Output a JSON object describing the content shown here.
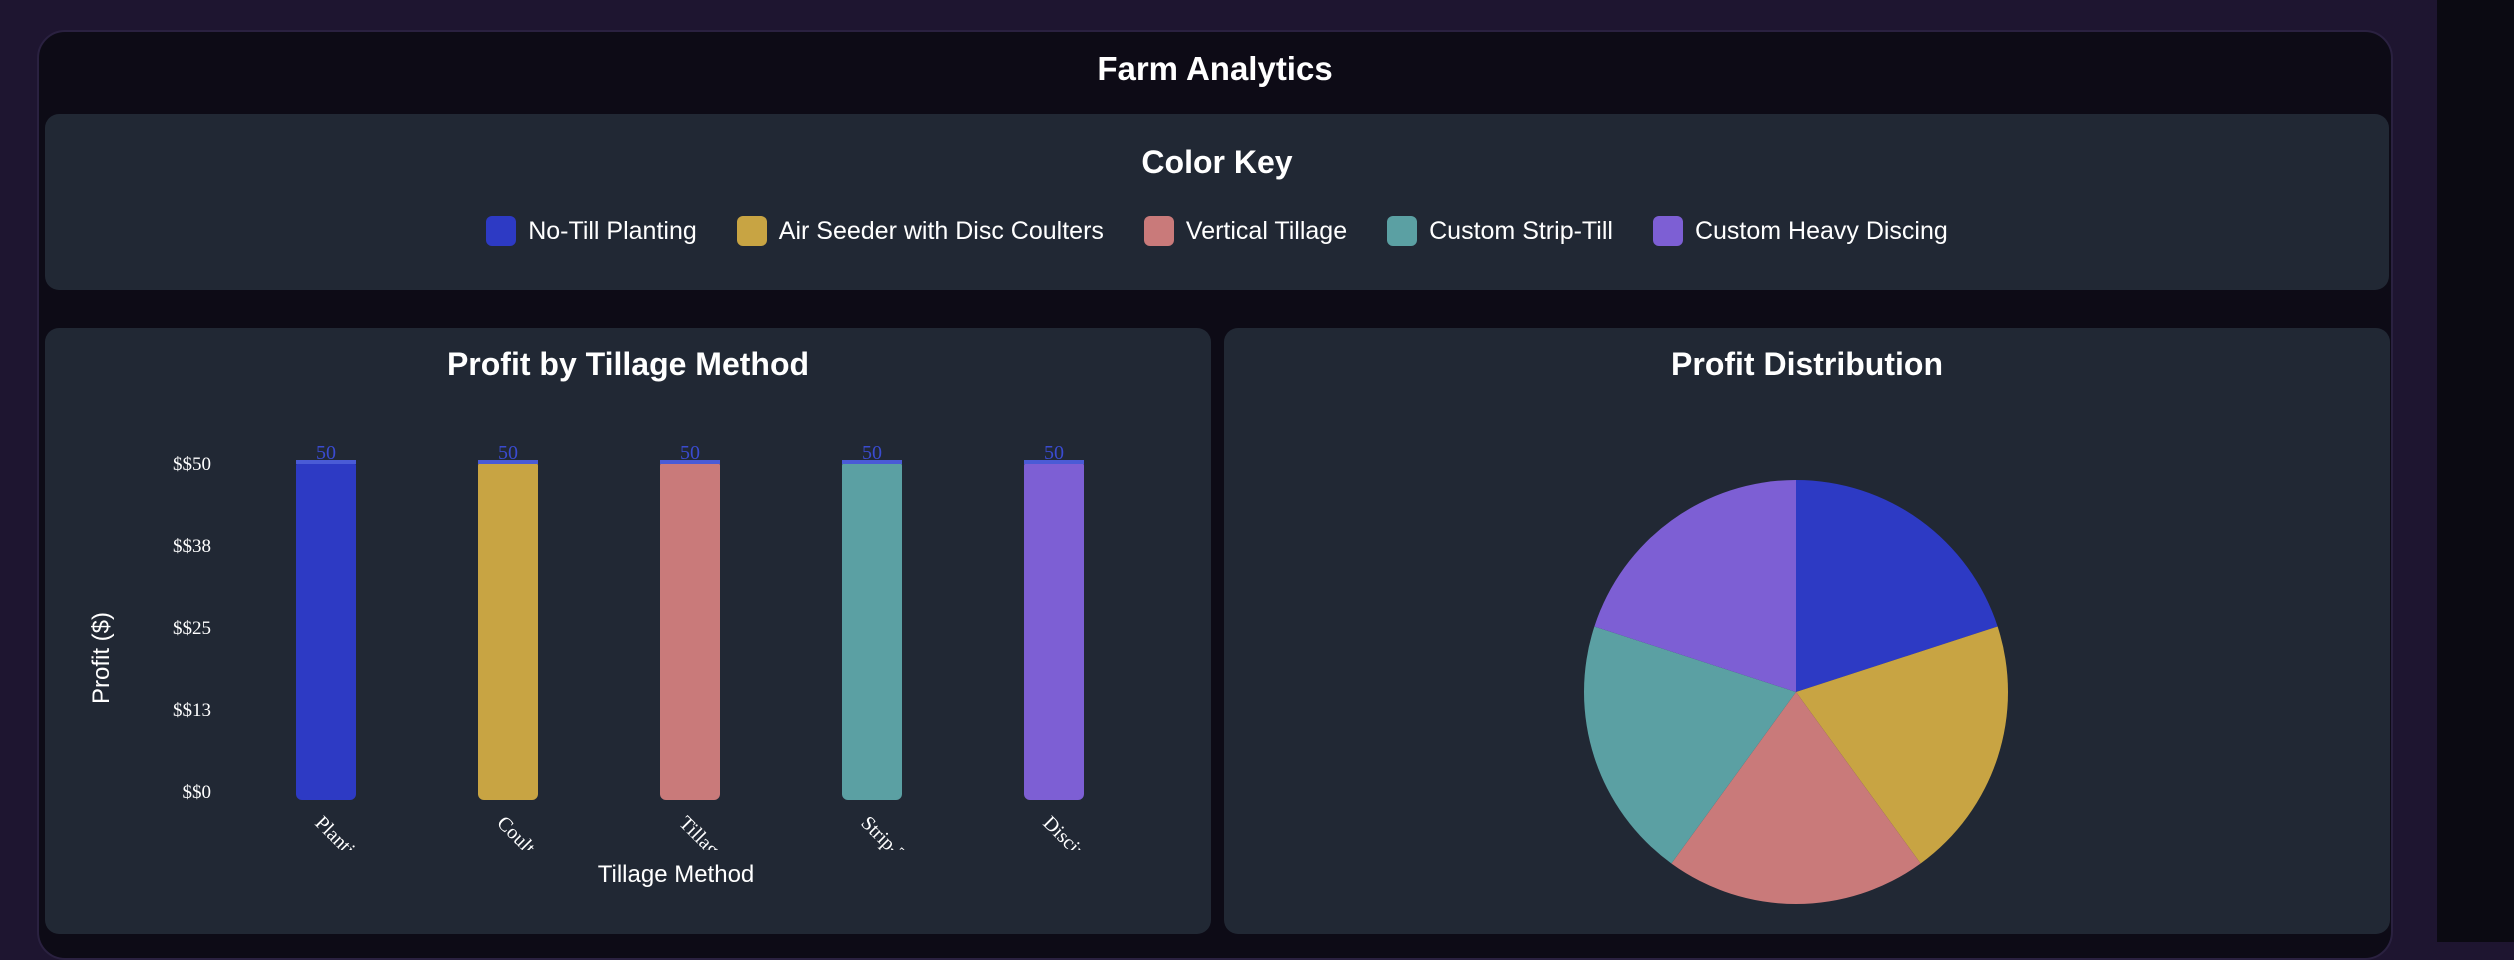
{
  "app": {
    "title": "Farm Analytics"
  },
  "legend": {
    "title": "Color Key",
    "items": [
      {
        "label": "No-Till Planting",
        "color": "#2d3ac4"
      },
      {
        "label": "Air Seeder with Disc Coulters",
        "color": "#c8a443"
      },
      {
        "label": "Vertical Tillage",
        "color": "#c97a7a"
      },
      {
        "label": "Custom Strip-Till",
        "color": "#5ba0a3"
      },
      {
        "label": "Custom Heavy Discing",
        "color": "#7d5fd4"
      }
    ]
  },
  "bar_panel": {
    "title": "Profit by Tillage Method"
  },
  "pie_panel": {
    "title": "Profit Distribution"
  },
  "chart_data": [
    {
      "type": "bar",
      "title": "Profit by Tillage Method",
      "xlabel": "Tillage Method",
      "ylabel": "Profit ($)",
      "categories": [
        "Planti",
        "Coult",
        "Tillag",
        "Strip-T",
        "Discir"
      ],
      "values": [
        50,
        50,
        50,
        50,
        50
      ],
      "colors": [
        "#2d3ac4",
        "#c8a443",
        "#c97a7a",
        "#5ba0a3",
        "#7d5fd4"
      ],
      "data_labels": [
        "50",
        "50",
        "50",
        "50",
        "50"
      ],
      "ylim": [
        0,
        50
      ],
      "y_ticks": [
        0,
        12.5,
        25,
        37.5,
        50
      ],
      "y_tick_labels": [
        "$$0",
        "$$13",
        "$$25",
        "$$38",
        "$$50"
      ],
      "grid": false,
      "accent_color": "#4a5bd6"
    },
    {
      "type": "pie",
      "title": "Profit Distribution",
      "labels": [
        "No-Till Planting",
        "Air Seeder with Disc Coulters",
        "Vertical Tillage",
        "Custom Strip-Till",
        "Custom Heavy Discing"
      ],
      "values": [
        50,
        50,
        50,
        50,
        50
      ],
      "colors": [
        "#2d3ac4",
        "#c8a443",
        "#c97a7a",
        "#5ba0a3",
        "#7d5fd4"
      ]
    }
  ]
}
